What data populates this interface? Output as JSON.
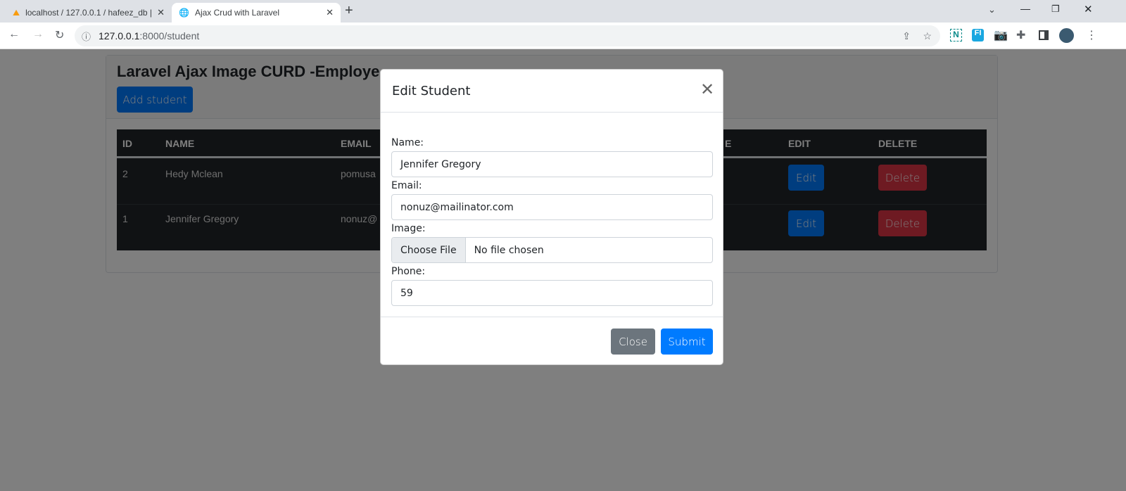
{
  "browser": {
    "tabs": [
      {
        "title": "localhost / 127.0.0.1 / hafeez_db |",
        "icon": "phpmyadmin-icon"
      },
      {
        "title": "Ajax Crud with Laravel",
        "icon": "globe-icon"
      }
    ],
    "url_host": "127.0.0.1",
    "url_path": ":8000/student"
  },
  "page": {
    "title": "Laravel Ajax Image CURD -Employe",
    "add_button": "Add student",
    "columns": [
      "ID",
      "NAME",
      "EMAIL",
      "E",
      "EDIT",
      "DELETE"
    ],
    "rows": [
      {
        "id": "2",
        "name": "Hedy Mclean",
        "email": "pomusa",
        "edit": "Edit",
        "delete": "Delete"
      },
      {
        "id": "1",
        "name": "Jennifer Gregory",
        "email": "nonuz@",
        "edit": "Edit",
        "delete": "Delete"
      }
    ]
  },
  "modal": {
    "title": "Edit Student",
    "name_label": "Name:",
    "name_value": "Jennifer Gregory",
    "email_label": "Email:",
    "email_value": "nonuz@mailinator.com",
    "image_label": "Image:",
    "choose_file": "Choose File",
    "no_file": "No file chosen",
    "phone_label": "Phone:",
    "phone_value": "59",
    "close": "Close",
    "submit": "Submit"
  },
  "colors": {
    "primary": "#007bff",
    "secondary": "#6c757d",
    "danger": "#dc3545",
    "dark": "#212529"
  }
}
